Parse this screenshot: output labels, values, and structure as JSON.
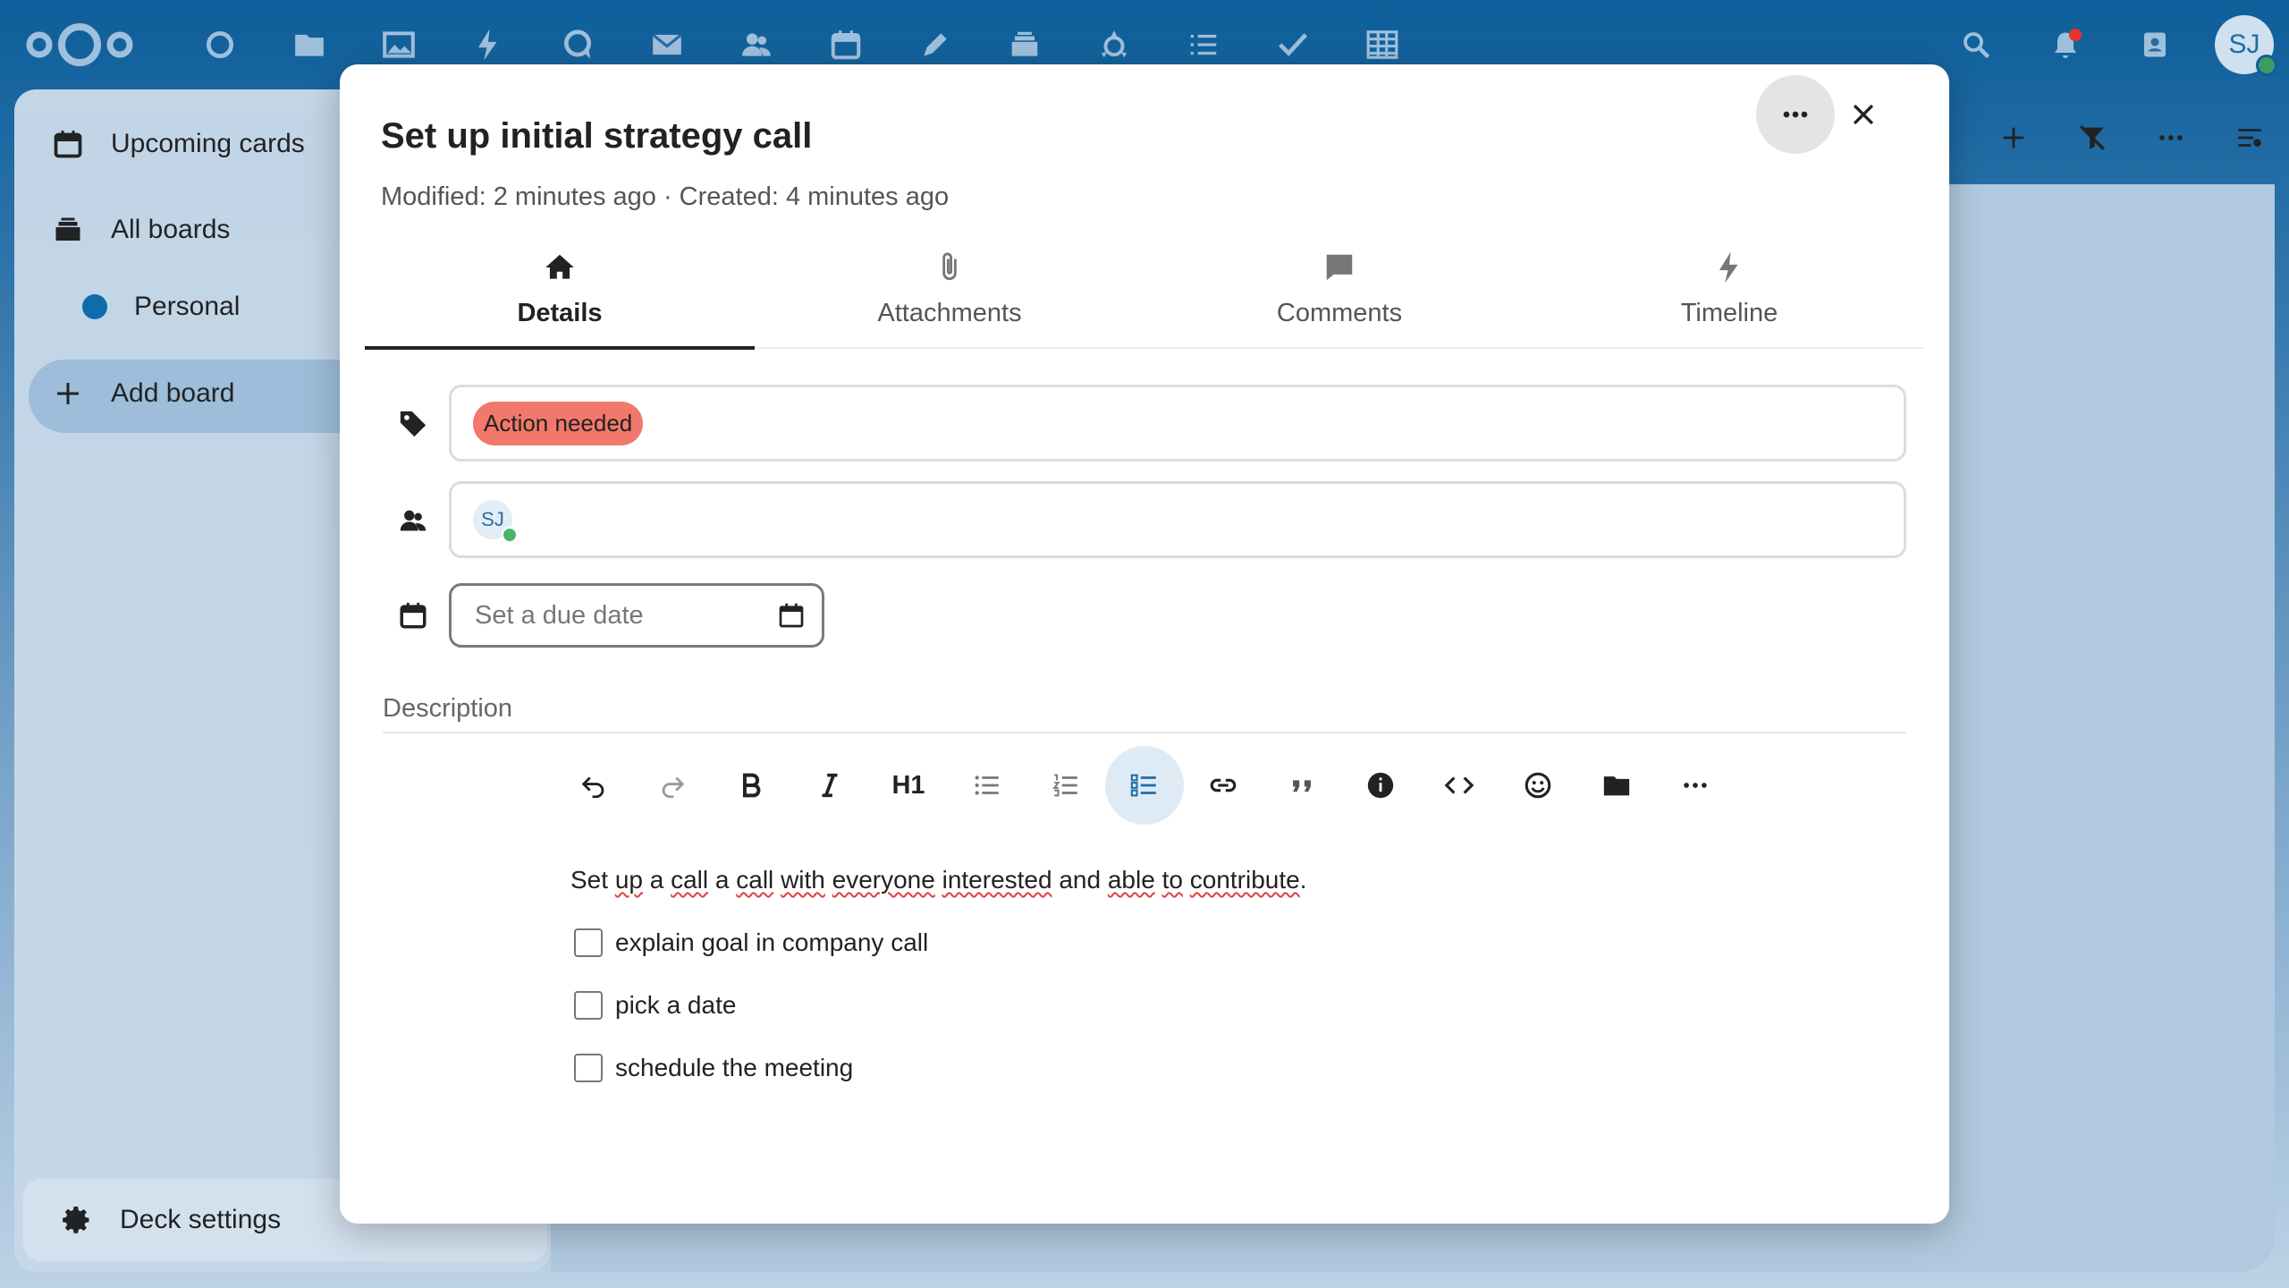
{
  "topbar": {
    "apps": [
      "dashboard-icon",
      "files-icon",
      "photos-icon",
      "activity-icon",
      "talk-icon",
      "mail-icon",
      "contacts-icon",
      "calendar-icon",
      "notes-icon",
      "deck-icon",
      "circles-icon",
      "tasks-list-icon",
      "checkmark-icon",
      "tables-icon"
    ],
    "user_initials": "SJ"
  },
  "sidebar": {
    "items": [
      {
        "label": "Upcoming cards",
        "icon": "calendar-icon"
      },
      {
        "label": "All boards",
        "icon": "stack-icon"
      },
      {
        "label": "Personal",
        "icon": "board-dot",
        "color": "#0e6cab"
      },
      {
        "label": "Add board",
        "icon": "plus-icon"
      }
    ],
    "settings_label": "Deck settings"
  },
  "card": {
    "title": "Set up initial strategy call",
    "meta": "Modified: 2 minutes ago · Created: 4 minutes ago",
    "tabs": [
      {
        "label": "Details",
        "icon": "home-icon",
        "active": true
      },
      {
        "label": "Attachments",
        "icon": "paperclip-icon"
      },
      {
        "label": "Comments",
        "icon": "comment-icon"
      },
      {
        "label": "Timeline",
        "icon": "lightning-icon"
      }
    ],
    "tag": {
      "label": "Action needed",
      "color": "#f1786b"
    },
    "assignee_initials": "SJ",
    "due_date_placeholder": "Set a due date",
    "description_label": "Description",
    "description_text_parts": [
      "Set ",
      "up",
      " a ",
      "call",
      " a ",
      "call",
      " ",
      "with",
      " ",
      "everyone",
      " ",
      "interested",
      " and ",
      "able",
      " ",
      "to",
      " ",
      "contribute",
      "."
    ],
    "tasks": [
      {
        "label": "explain goal in company call",
        "checked": false
      },
      {
        "label": "pick a date",
        "checked": false
      },
      {
        "label": "schedule the meeting",
        "checked": false
      }
    ],
    "toolbar_heading_label": "H1"
  }
}
